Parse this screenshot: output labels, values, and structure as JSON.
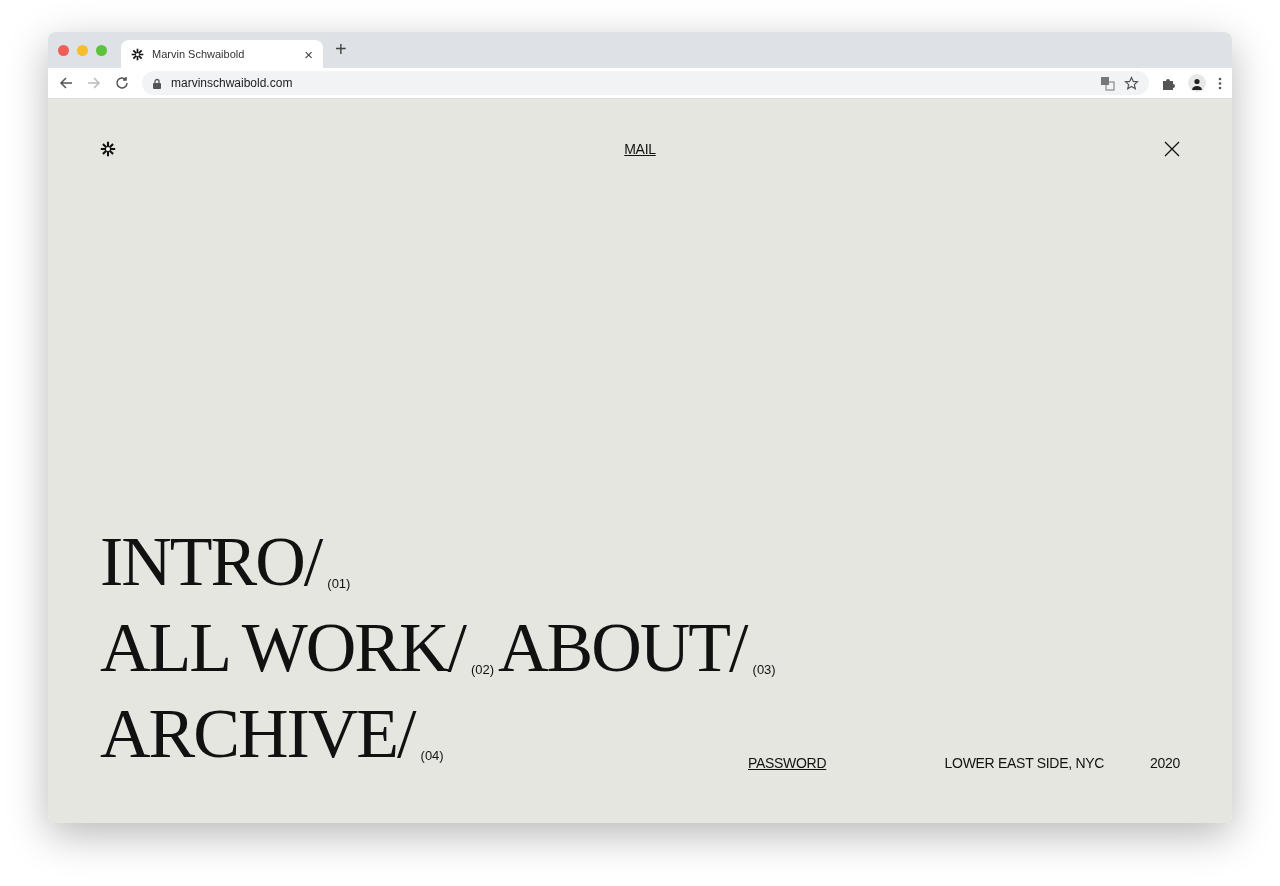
{
  "browser": {
    "tab_title": "Marvin Schwaibold",
    "close_tab": "×",
    "new_tab": "+",
    "url": "marvinschwaibold.com"
  },
  "header": {
    "mail_link": "MAIL"
  },
  "nav_rows": [
    {
      "items": [
        {
          "label": "INTRO/",
          "index": "(01)"
        }
      ]
    },
    {
      "items": [
        {
          "label": "ALL WORK/",
          "index": "(02)"
        },
        {
          "label": "ABOUT/",
          "index": "(03)"
        }
      ]
    },
    {
      "items": [
        {
          "label": "ARCHIVE/",
          "index": "(04)"
        }
      ]
    }
  ],
  "footer": {
    "password_link": "PASSWORD",
    "location": "LOWER EAST SIDE, NYC",
    "year": "2020"
  }
}
